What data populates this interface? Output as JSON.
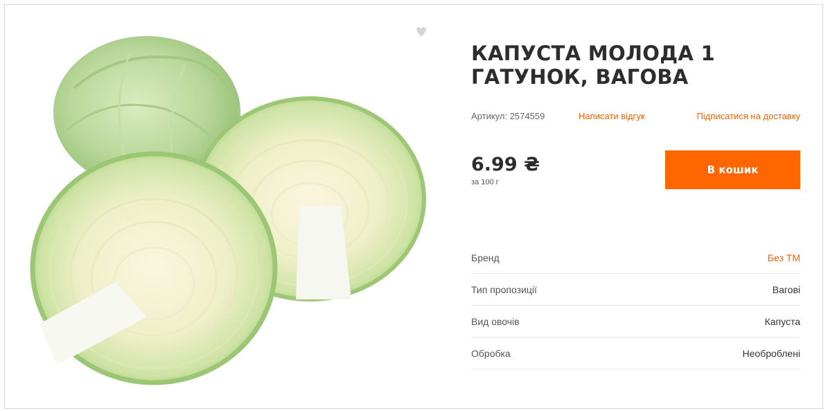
{
  "product": {
    "title": "КАПУСТА МОЛОДА 1 ГАТУНОК, ВАГОВА",
    "sku_label": "Артикул: 2574559",
    "review_link": "Написати відгук",
    "subscribe_link": "Підписатися на доставку",
    "price": "6.99 ₴",
    "price_unit": "за 100 г",
    "cart_button": "В кошик",
    "favorite_icon": "heart-icon",
    "image": "cabbage-product-photo"
  },
  "properties": [
    {
      "name": "Бренд",
      "value": "Без ТМ",
      "link": true
    },
    {
      "name": "Тип пропозиції",
      "value": "Вагові",
      "link": false
    },
    {
      "name": "Вид овочів",
      "value": "Капуста",
      "link": false
    },
    {
      "name": "Обробка",
      "value": "Необроблені",
      "link": false
    }
  ],
  "colors": {
    "accent": "#ff6600",
    "link": "#f06200",
    "title": "#2d2d2d"
  }
}
